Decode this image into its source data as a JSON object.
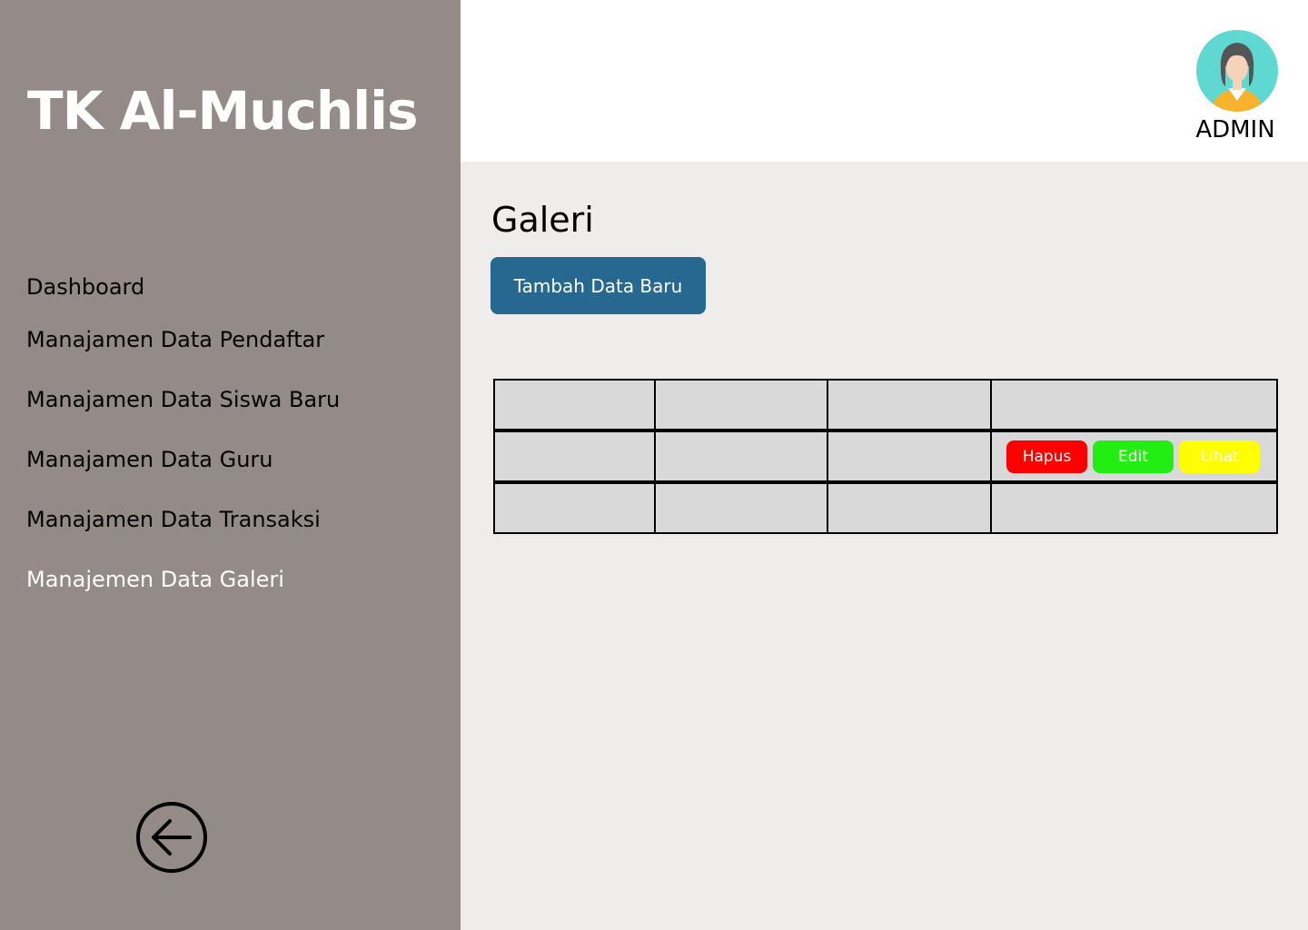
{
  "sidebar": {
    "brand": "TK Al-Muchlis",
    "items": [
      {
        "label": "Dashboard",
        "active": false
      },
      {
        "label": "Manajamen Data Pendaftar",
        "active": false
      },
      {
        "label": "Manajamen Data Siswa Baru",
        "active": false
      },
      {
        "label": "Manajamen Data Guru",
        "active": false
      },
      {
        "label": "Manajamen Data Transaksi",
        "active": false
      },
      {
        "label": "Manajemen Data Galeri",
        "active": true
      }
    ],
    "back_icon": "arrow-left-circle-icon",
    "bg_color": "#948a88"
  },
  "header": {
    "user_label": "ADMIN",
    "avatar_icon": "female-avatar-icon"
  },
  "main": {
    "title": "Galeri",
    "add_button_label": "Tambah Data Baru",
    "add_button_color": "#266890",
    "table": {
      "rows": [
        {
          "cells": [
            "",
            "",
            "",
            ""
          ],
          "actions": []
        },
        {
          "cells": [
            "",
            "",
            "",
            ""
          ],
          "actions": [
            {
              "label": "Hapus",
              "color": "#ff0000"
            },
            {
              "label": "Edit",
              "color": "#22ee11"
            },
            {
              "label": "Lihat",
              "color": "#ffff00"
            }
          ]
        },
        {
          "cells": [
            "",
            "",
            "",
            ""
          ],
          "actions": []
        }
      ]
    }
  }
}
